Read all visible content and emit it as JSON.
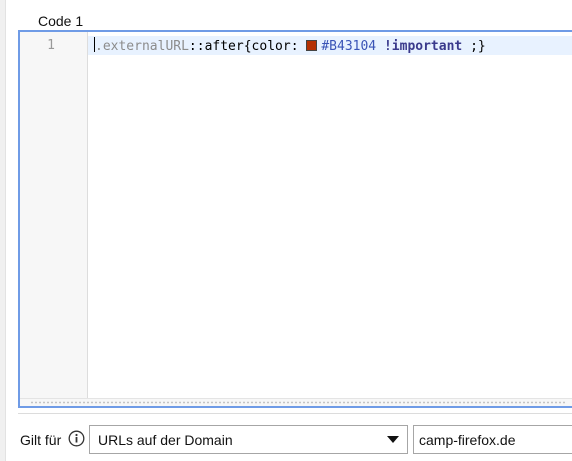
{
  "section": {
    "title": "Code 1"
  },
  "editor": {
    "line_number": "1",
    "code": {
      "selector_class": ".externalURL",
      "pseudo_colons": "::",
      "pseudo_element": "after",
      "open_brace": "{",
      "property": "color",
      "colon": ": ",
      "swatch_color": "#B43104",
      "value": "#B43104",
      "important": "!important",
      "close": " ;}"
    }
  },
  "applies": {
    "label": "Gilt für",
    "info_icon": "info-icon",
    "scope_selected": "URLs auf der Domain",
    "domain_value": "camp-firefox.de"
  }
}
